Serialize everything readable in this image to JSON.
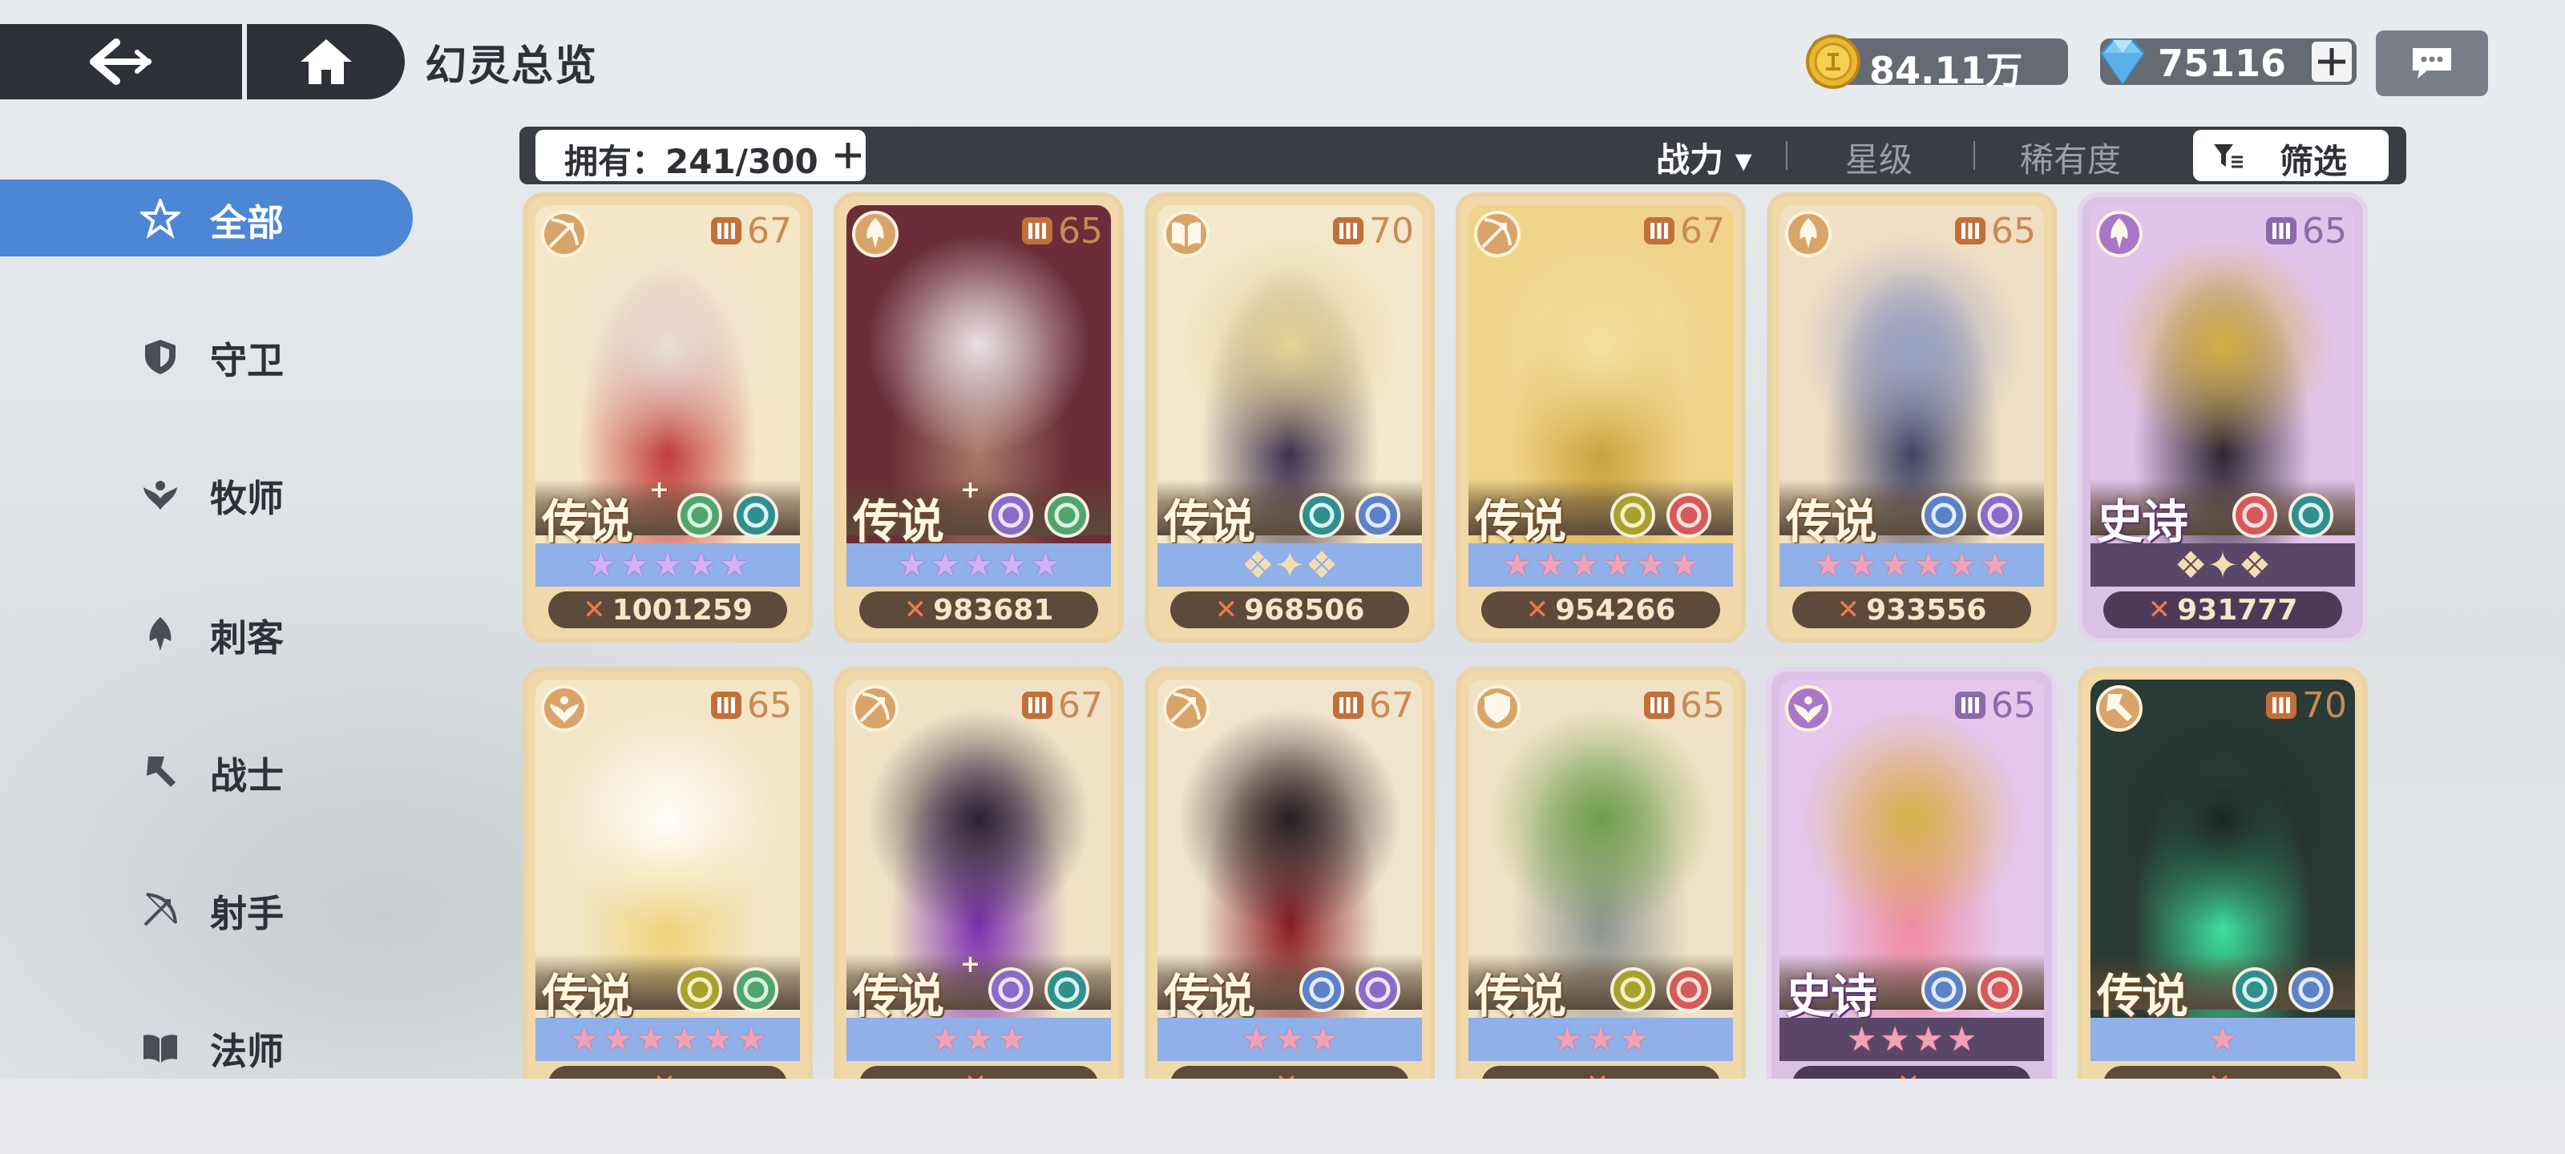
{
  "header": {
    "title": "幻灵总览",
    "gold": "84.11万",
    "gems": "75116"
  },
  "sidebar": {
    "items": [
      {
        "label": "全部",
        "icon": "all-icon",
        "active": true
      },
      {
        "label": "守卫",
        "icon": "guard-icon",
        "active": false
      },
      {
        "label": "牧师",
        "icon": "priest-icon",
        "active": false
      },
      {
        "label": "刺客",
        "icon": "assassin-icon",
        "active": false
      },
      {
        "label": "战士",
        "icon": "warrior-icon",
        "active": false
      },
      {
        "label": "射手",
        "icon": "archer-icon",
        "active": false
      },
      {
        "label": "法师",
        "icon": "mage-icon",
        "active": false
      }
    ]
  },
  "filterbar": {
    "owned": "拥有：241/300",
    "sort_power": "战力 ▾",
    "sort_stars": "星级",
    "sort_rarity": "稀有度",
    "filter": "筛选"
  },
  "colors": {
    "accent": "#4c86d4",
    "dark": "#2f3138",
    "legend_card": "#f1d8a8",
    "epic_card": "#dcc1e6"
  },
  "cards": [
    {
      "rarity": "传说",
      "plus": true,
      "level": "67",
      "power": "1001259",
      "role": "archer-icon",
      "elements": [
        "leaf",
        "water"
      ],
      "stars": 5,
      "star_type": "violet",
      "type": "legend",
      "art": [
        "#f6e6c8",
        "#c13a3a",
        "#e8e0d8"
      ]
    },
    {
      "rarity": "传说",
      "plus": true,
      "level": "65",
      "power": "983681",
      "role": "assassin-icon",
      "elements": [
        "void",
        "leaf"
      ],
      "stars": 5,
      "star_type": "violet",
      "type": "legend",
      "art": [
        "#6b2d3a",
        "#a97a66",
        "#e8e0e4"
      ]
    },
    {
      "rarity": "传说",
      "plus": false,
      "level": "70",
      "power": "968506",
      "role": "mage-icon",
      "elements": [
        "water",
        "light"
      ],
      "stars": 0,
      "star_type": "crest",
      "type": "legend",
      "art": [
        "#f4e8cc",
        "#3a2f4c",
        "#e6d294"
      ]
    },
    {
      "rarity": "传说",
      "plus": false,
      "level": "67",
      "power": "954266",
      "role": "archer-icon",
      "elements": [
        "wind",
        "fire"
      ],
      "stars": 6,
      "star_type": "pink",
      "type": "legend",
      "art": [
        "#f0d48a",
        "#c9a43c",
        "#f6e2a0"
      ]
    },
    {
      "rarity": "传说",
      "plus": false,
      "level": "65",
      "power": "933556",
      "role": "assassin-icon",
      "elements": [
        "light",
        "void"
      ],
      "stars": 6,
      "star_type": "pink",
      "type": "legend",
      "art": [
        "#f0dfc4",
        "#3e4366",
        "#9aa3c8"
      ]
    },
    {
      "rarity": "史诗",
      "plus": false,
      "level": "65",
      "power": "931777",
      "role": "assassin-icon",
      "elements": [
        "fire",
        "water"
      ],
      "stars": 0,
      "star_type": "crest",
      "type": "epic",
      "art": [
        "#e2c3ea",
        "#2b2430",
        "#d2b043"
      ]
    },
    {
      "rarity": "传说",
      "plus": false,
      "level": "65",
      "power": "",
      "role": "priest-icon",
      "elements": [
        "wind",
        "leaf"
      ],
      "stars": 6,
      "star_type": "pink",
      "type": "legend",
      "art": [
        "#f3e6c6",
        "#f0d27a",
        "#ffffff"
      ]
    },
    {
      "rarity": "传说",
      "plus": true,
      "level": "67",
      "power": "",
      "role": "archer-icon",
      "elements": [
        "void",
        "water"
      ],
      "stars": 3,
      "star_type": "pink",
      "type": "legend",
      "art": [
        "#f1e2c6",
        "#7a2fb0",
        "#2a2230"
      ]
    },
    {
      "rarity": "传说",
      "plus": false,
      "level": "67",
      "power": "",
      "role": "archer-icon",
      "elements": [
        "light",
        "void"
      ],
      "stars": 3,
      "star_type": "pink",
      "type": "legend",
      "art": [
        "#f1e4cc",
        "#8a1d24",
        "#242024"
      ]
    },
    {
      "rarity": "传说",
      "plus": false,
      "level": "65",
      "power": "",
      "role": "guard-icon",
      "elements": [
        "wind",
        "fire"
      ],
      "stars": 3,
      "star_type": "pink",
      "type": "legend",
      "art": [
        "#f0e2c6",
        "#8e9490",
        "#6ea04a"
      ]
    },
    {
      "rarity": "史诗",
      "plus": false,
      "level": "65",
      "power": "",
      "role": "priest-icon",
      "elements": [
        "light",
        "fire"
      ],
      "stars": 4,
      "star_type": "pink",
      "type": "epic",
      "art": [
        "#e6c6ec",
        "#f08aa0",
        "#d8b24a"
      ]
    },
    {
      "rarity": "传说",
      "plus": false,
      "level": "70",
      "power": "",
      "role": "warrior-icon",
      "elements": [
        "water",
        "light"
      ],
      "stars": 1,
      "star_type": "pink",
      "type": "legend",
      "art": [
        "#2a3a34",
        "#3ee0a0",
        "#1e2522"
      ]
    }
  ]
}
